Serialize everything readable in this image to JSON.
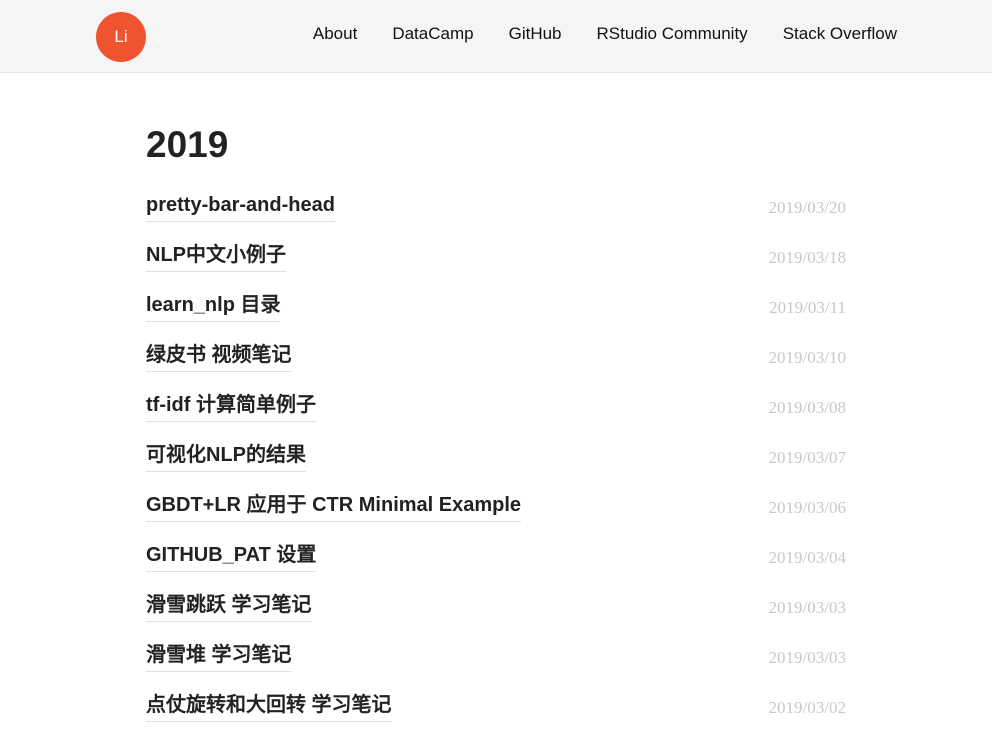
{
  "header": {
    "logo_text": "Li",
    "nav": [
      "About",
      "DataCamp",
      "GitHub",
      "RStudio Community",
      "Stack Overflow"
    ]
  },
  "archive": {
    "year": "2019",
    "posts": [
      {
        "title": "pretty-bar-and-head",
        "date": "2019/03/20"
      },
      {
        "title": "NLP中文小例子",
        "date": "2019/03/18"
      },
      {
        "title": "learn_nlp 目录",
        "date": "2019/03/11"
      },
      {
        "title": "绿皮书 视频笔记",
        "date": "2019/03/10"
      },
      {
        "title": "tf-idf 计算简单例子",
        "date": "2019/03/08"
      },
      {
        "title": "可视化NLP的结果",
        "date": "2019/03/07"
      },
      {
        "title": "GBDT+LR 应用于 CTR Minimal Example",
        "date": "2019/03/06"
      },
      {
        "title": "GITHUB_PAT 设置",
        "date": "2019/03/04"
      },
      {
        "title": "滑雪跳跃 学习笔记",
        "date": "2019/03/03"
      },
      {
        "title": "滑雪堆 学习笔记",
        "date": "2019/03/03"
      },
      {
        "title": "点仗旋转和大回转 学习笔记",
        "date": "2019/03/02"
      }
    ]
  },
  "colors": {
    "logo_bg": "#f0532f",
    "header_bg": "#f5f5f5",
    "date_text": "#c8c8c8"
  }
}
